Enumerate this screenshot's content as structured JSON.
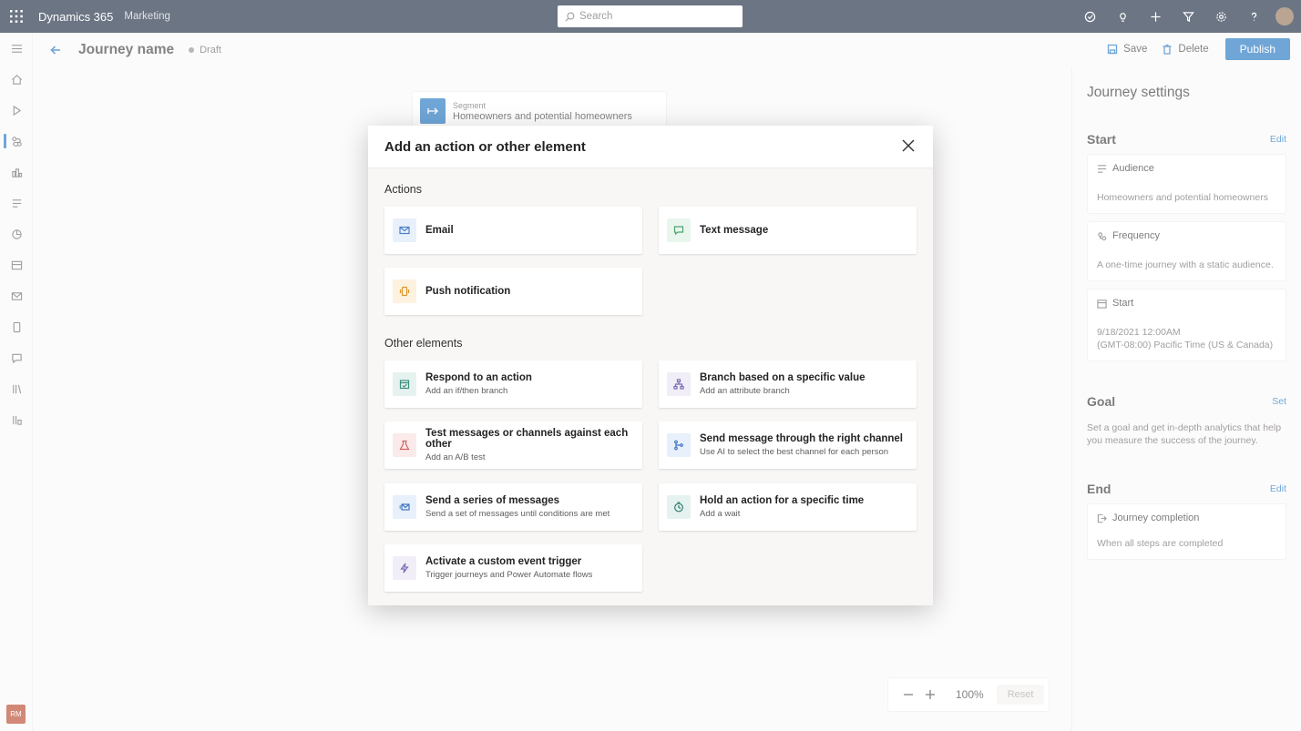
{
  "topbar": {
    "app_name": "Dynamics 365",
    "module": "Marketing",
    "search_placeholder": "Search"
  },
  "header": {
    "title": "Journey name",
    "status": "Draft",
    "save": "Save",
    "delete": "Delete",
    "publish": "Publish"
  },
  "canvas": {
    "segment": {
      "kind": "Segment",
      "name": "Homeowners and potential homeowners"
    },
    "zoom": {
      "value": "100%",
      "reset": "Reset"
    }
  },
  "settings": {
    "title": "Journey settings",
    "start": {
      "heading": "Start",
      "action": "Edit",
      "audience": {
        "label": "Audience",
        "value": "Homeowners and potential homeowners"
      },
      "frequency": {
        "label": "Frequency",
        "value": "A one-time journey with a static audience."
      },
      "start": {
        "label": "Start",
        "date": "9/18/2021 12:00AM",
        "zone": "(GMT-08:00) Pacific Time (US & Canada)"
      }
    },
    "goal": {
      "heading": "Goal",
      "action": "Set",
      "text": "Set a goal and get in-depth analytics that help you measure the success of the journey."
    },
    "end": {
      "heading": "End",
      "action": "Edit",
      "card_label": "Journey completion",
      "card_value": "When all steps are completed"
    }
  },
  "user": {
    "initials": "RM"
  },
  "dialog": {
    "title": "Add an action or other element",
    "actions_label": "Actions",
    "actions": [
      {
        "title": "Email"
      },
      {
        "title": "Text message"
      },
      {
        "title": "Push notification"
      }
    ],
    "other_label": "Other elements",
    "other": [
      {
        "title": "Respond to an action",
        "sub": "Add an if/then branch"
      },
      {
        "title": "Branch based on a specific value",
        "sub": "Add an attribute branch"
      },
      {
        "title": "Test messages or channels against each other",
        "sub": "Add an A/B test"
      },
      {
        "title": "Send message through the right channel",
        "sub": "Use AI to select the best channel for each person"
      },
      {
        "title": "Send a series of messages",
        "sub": "Send a set of messages until conditions are met"
      },
      {
        "title": "Hold an action for a specific time",
        "sub": "Add a wait"
      },
      {
        "title": "Activate a custom event trigger",
        "sub": "Trigger journeys and Power Automate flows"
      }
    ]
  }
}
